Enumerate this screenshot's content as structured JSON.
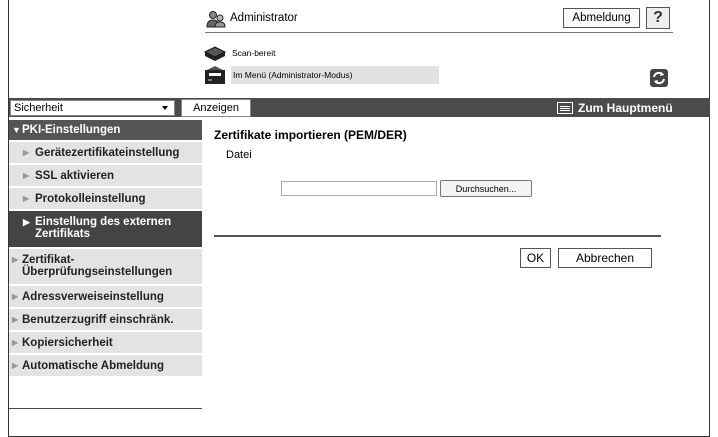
{
  "header": {
    "user": "Administrator",
    "logout_label": "Abmeldung",
    "help_label": "?",
    "scan_status": "Scan-bereit",
    "mode_status": "Im Menü (Administrator-Modus)"
  },
  "toolbar": {
    "section_selected": "Sicherheit",
    "show_label": "Anzeigen",
    "main_menu_label": "Zum Hauptmenü"
  },
  "sidebar": {
    "items": [
      {
        "label": "PKI-Einstellungen"
      },
      {
        "label": "Gerätezertifikateinstellung"
      },
      {
        "label": "SSL aktivieren"
      },
      {
        "label": "Protokolleinstellung"
      },
      {
        "label": "Einstellung des externen Zertifikats"
      },
      {
        "label": "Zertifikat-Überprüfungseinstellungen"
      },
      {
        "label": "Adressverweiseinstellung"
      },
      {
        "label": "Benutzerzugriff einschränk."
      },
      {
        "label": "Kopiersicherheit"
      },
      {
        "label": "Automatische Abmeldung"
      }
    ]
  },
  "main": {
    "title": "Zertifikate importieren (PEM/DER)",
    "file_label": "Datei",
    "file_value": "",
    "browse_label": "Durchsuchen...",
    "ok_label": "OK",
    "cancel_label": "Abbrechen"
  },
  "icons": {
    "admin": "admin-user-icon",
    "scanner": "scanner-icon",
    "printer": "printer-icon",
    "refresh": "refresh-icon",
    "main_menu": "main-menu-icon"
  },
  "colors": {
    "toolbar_bg": "#4b4b4b",
    "nav_active_bg": "#444444",
    "nav_bg": "#e3e3e3"
  }
}
